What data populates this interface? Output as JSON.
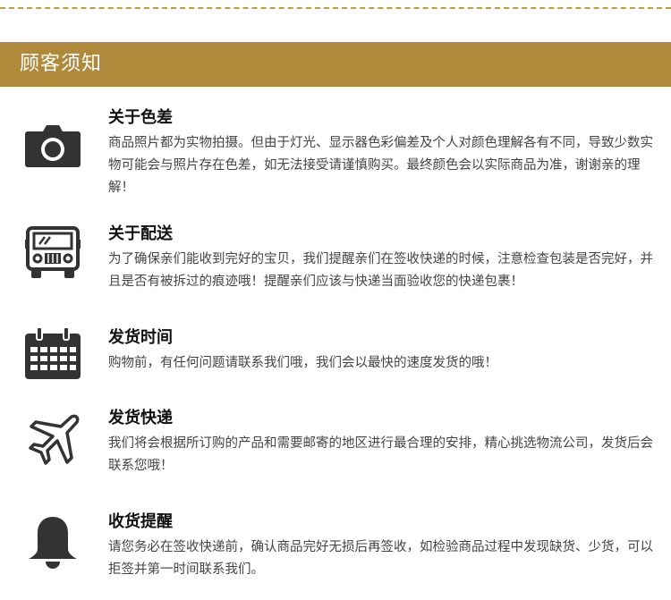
{
  "header": {
    "title": "顾客须知"
  },
  "sections": [
    {
      "icon": "camera-icon",
      "title": "关于色差",
      "body": "商品照片都为实物拍摄。但由于灯光、显示器色彩偏差及个人对颜色理解各有不同，导致少数实物可能会与照片存在色差，如无法接受请谨慎购买。最终颜色会以实际商品为准，谢谢亲的理解！"
    },
    {
      "icon": "delivery-truck-icon",
      "title": "关于配送",
      "body": "为了确保亲们能收到完好的宝贝，我们提醒亲们在签收快递的时候，注意检查包装是否完好，并且是否有被拆过的痕迹哦！提醒亲们应该与快递当面验收您的快递包裹！"
    },
    {
      "icon": "calendar-icon",
      "title": "发货时间",
      "body": "购物前，有任何问题请联系我们哦，我们会以最快的速度发货的哦！"
    },
    {
      "icon": "airplane-icon",
      "title": "发货快递",
      "body": "我们将会根据所订购的产品和需要邮寄的地区进行最合理的安排，精心挑选物流公司，发货后会联系您哦！"
    },
    {
      "icon": "bell-icon",
      "title": "收货提醒",
      "body": "请您务必在签收快递前，确认商品完好无损后再签收，如检验商品过程中发现缺货、少货，可以拒签并第一时间联系我们。"
    }
  ],
  "colors": {
    "header_bg": "#b0893b",
    "dashed_rule": "#c49a3a",
    "icon_fill": "#333333",
    "title_text": "#111111",
    "body_text": "#444444"
  }
}
